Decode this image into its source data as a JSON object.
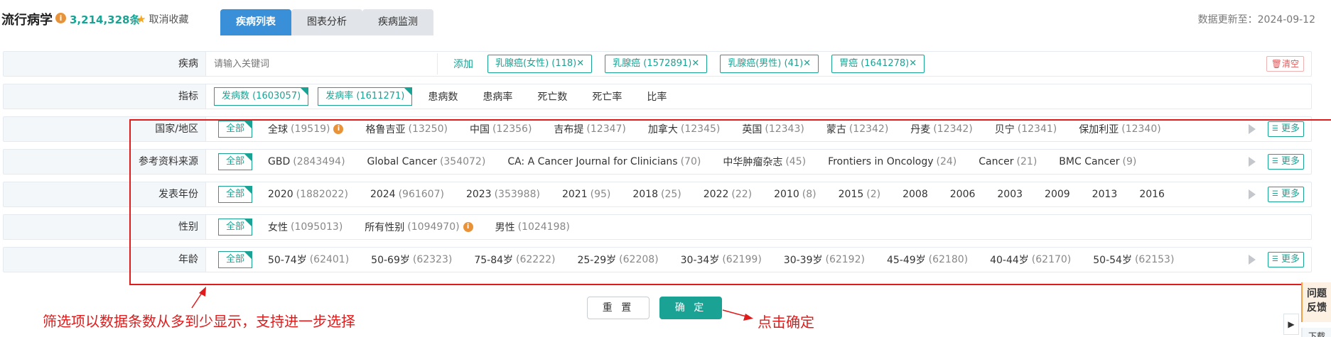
{
  "header": {
    "title": "流行病学",
    "record_count": "3,214,328条",
    "favorite_label": "取消收藏",
    "tabs": [
      {
        "label": "疾病列表",
        "active": true
      },
      {
        "label": "图表分析",
        "active": false
      },
      {
        "label": "疾病监测",
        "active": false
      }
    ],
    "update_text": "数据更新至：2024-09-12"
  },
  "disease_row": {
    "label": "疾病",
    "search_placeholder": "请输入关键词",
    "add_label": "添加",
    "chips": [
      "乳腺癌(女性) (118)✕",
      "乳腺癌 (1572891)✕",
      "乳腺癌(男性) (41)✕",
      "胃癌 (1641278)✕"
    ],
    "clear_label": "清空"
  },
  "indicator_row": {
    "label": "指标",
    "selected": [
      "发病数 (1603057)",
      "发病率 (1611271)"
    ],
    "others": [
      "患病数",
      "患病率",
      "死亡数",
      "死亡率",
      "比率"
    ]
  },
  "filters": {
    "all_label": "全部",
    "more_label": "更多",
    "country": {
      "label": "国家/地区",
      "options": [
        {
          "name": "全球",
          "count": "(19519)",
          "info": true
        },
        {
          "name": "格鲁吉亚",
          "count": "(13250)"
        },
        {
          "name": "中国",
          "count": "(12356)"
        },
        {
          "name": "吉布提",
          "count": "(12347)"
        },
        {
          "name": "加拿大",
          "count": "(12345)"
        },
        {
          "name": "英国",
          "count": "(12343)"
        },
        {
          "name": "蒙古",
          "count": "(12342)"
        },
        {
          "name": "丹麦",
          "count": "(12342)"
        },
        {
          "name": "贝宁",
          "count": "(12341)"
        },
        {
          "name": "保加利亚",
          "count": "(12340)"
        }
      ]
    },
    "source": {
      "label": "参考资料来源",
      "options": [
        {
          "name": "GBD",
          "count": "(2843494)"
        },
        {
          "name": "Global Cancer",
          "count": "(354072)"
        },
        {
          "name": "CA: A Cancer Journal for Clinicians",
          "count": "(70)"
        },
        {
          "name": "中华肿瘤杂志",
          "count": "(45)"
        },
        {
          "name": "Frontiers in Oncology",
          "count": "(24)"
        },
        {
          "name": "Cancer",
          "count": "(21)"
        },
        {
          "name": "BMC Cancer",
          "count": "(9)"
        }
      ]
    },
    "year": {
      "label": "发表年份",
      "options": [
        {
          "name": "2020",
          "count": "(1882022)"
        },
        {
          "name": "2024",
          "count": "(961607)"
        },
        {
          "name": "2023",
          "count": "(353988)"
        },
        {
          "name": "2021",
          "count": "(95)"
        },
        {
          "name": "2018",
          "count": "(25)"
        },
        {
          "name": "2022",
          "count": "(22)"
        },
        {
          "name": "2010",
          "count": "(8)"
        },
        {
          "name": "2015",
          "count": "(2)"
        },
        {
          "name": "2008",
          "count": ""
        },
        {
          "name": "2006",
          "count": ""
        },
        {
          "name": "2003",
          "count": ""
        },
        {
          "name": "2009",
          "count": ""
        },
        {
          "name": "2013",
          "count": ""
        },
        {
          "name": "2016",
          "count": ""
        }
      ]
    },
    "gender": {
      "label": "性别",
      "options": [
        {
          "name": "女性",
          "count": "(1095013)"
        },
        {
          "name": "所有性别",
          "count": "(1094970)",
          "info": true
        },
        {
          "name": "男性",
          "count": "(1024198)"
        }
      ]
    },
    "age": {
      "label": "年龄",
      "options": [
        {
          "name": "50-74岁",
          "count": "(62401)"
        },
        {
          "name": "50-69岁",
          "count": "(62323)"
        },
        {
          "name": "75-84岁",
          "count": "(62222)"
        },
        {
          "name": "25-29岁",
          "count": "(62208)"
        },
        {
          "name": "30-34岁",
          "count": "(62199)"
        },
        {
          "name": "30-39岁",
          "count": "(62192)"
        },
        {
          "name": "45-49岁",
          "count": "(62180)"
        },
        {
          "name": "40-44岁",
          "count": "(62170)"
        },
        {
          "name": "50-54岁",
          "count": "(62153)"
        }
      ]
    }
  },
  "actions": {
    "reset_label": "重 置",
    "confirm_label": "确 定"
  },
  "annotations": {
    "left": "筛选项以数据条数从多到少显示，支持进一步选择",
    "right": "点击确定"
  },
  "side": {
    "feedback_line1": "问题",
    "feedback_line2": "反馈",
    "bottom_text": "下载"
  },
  "colors": {
    "accent": "#1aa394",
    "tab_active": "#3a8fd9",
    "annotation": "#e01b1b"
  }
}
